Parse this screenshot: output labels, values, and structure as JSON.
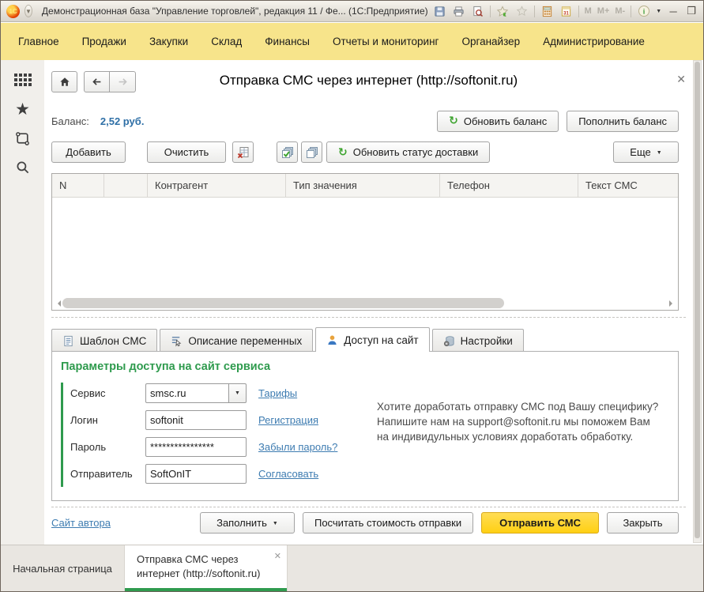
{
  "titlebar": {
    "logo_text": "1С",
    "title": "Демонстрационная база \"Управление торговлей\", редакция 11 / Фе...  (1С:Предприятие)",
    "memory_buttons": [
      "M",
      "M+",
      "M-"
    ]
  },
  "menu": {
    "items": [
      "Главное",
      "Продажи",
      "Закупки",
      "Склад",
      "Финансы",
      "Отчеты и мониторинг",
      "Органайзер",
      "Администрирование"
    ]
  },
  "header": {
    "title": "Отправка СМС через интернет (http://softonit.ru)"
  },
  "balance": {
    "label": "Баланс:",
    "value": "2,52 руб.",
    "refresh_button": "Обновить баланс",
    "topup_button": "Пополнить баланс"
  },
  "toolbar": {
    "add_button": "Добавить",
    "clear_button": "Очистить",
    "refresh_status_button": "Обновить статус доставки",
    "more_button": "Еще"
  },
  "table": {
    "columns": [
      "N",
      "",
      "Контрагент",
      "Тип значения",
      "Телефон",
      "Текст СМС"
    ]
  },
  "tabs": {
    "template": "Шаблон СМС",
    "variables": "Описание переменных",
    "access": "Доступ на сайт",
    "settings": "Настройки"
  },
  "access_panel": {
    "heading": "Параметры доступа на сайт сервиса",
    "service_label": "Сервис",
    "service_value": "smsc.ru",
    "service_link": "Тарифы",
    "login_label": "Логин",
    "login_value": "softonit",
    "login_link": "Регистрация",
    "password_label": "Пароль",
    "password_value": "****************",
    "password_link": "Забыли пароль?",
    "sender_label": "Отправитель",
    "sender_value": "SoftOnIT",
    "sender_link": "Согласовать",
    "note_line1": "Хотите доработать отправку СМС под Вашу специфику?",
    "note_line2": "Напишите нам на support@softonit.ru мы поможем Вам",
    "note_line3": "на индивидульных условиях доработать обработку."
  },
  "footer": {
    "author_link": "Сайт автора",
    "fill_button": "Заполнить",
    "calc_button": "Посчитать стоимость отправки",
    "send_button": "Отправить СМС",
    "close_button": "Закрыть"
  },
  "taskbar": {
    "home_tab": "Начальная страница",
    "sms_tab_line1": "Отправка СМС через",
    "sms_tab_line2": "интернет (http://softonit.ru)"
  }
}
